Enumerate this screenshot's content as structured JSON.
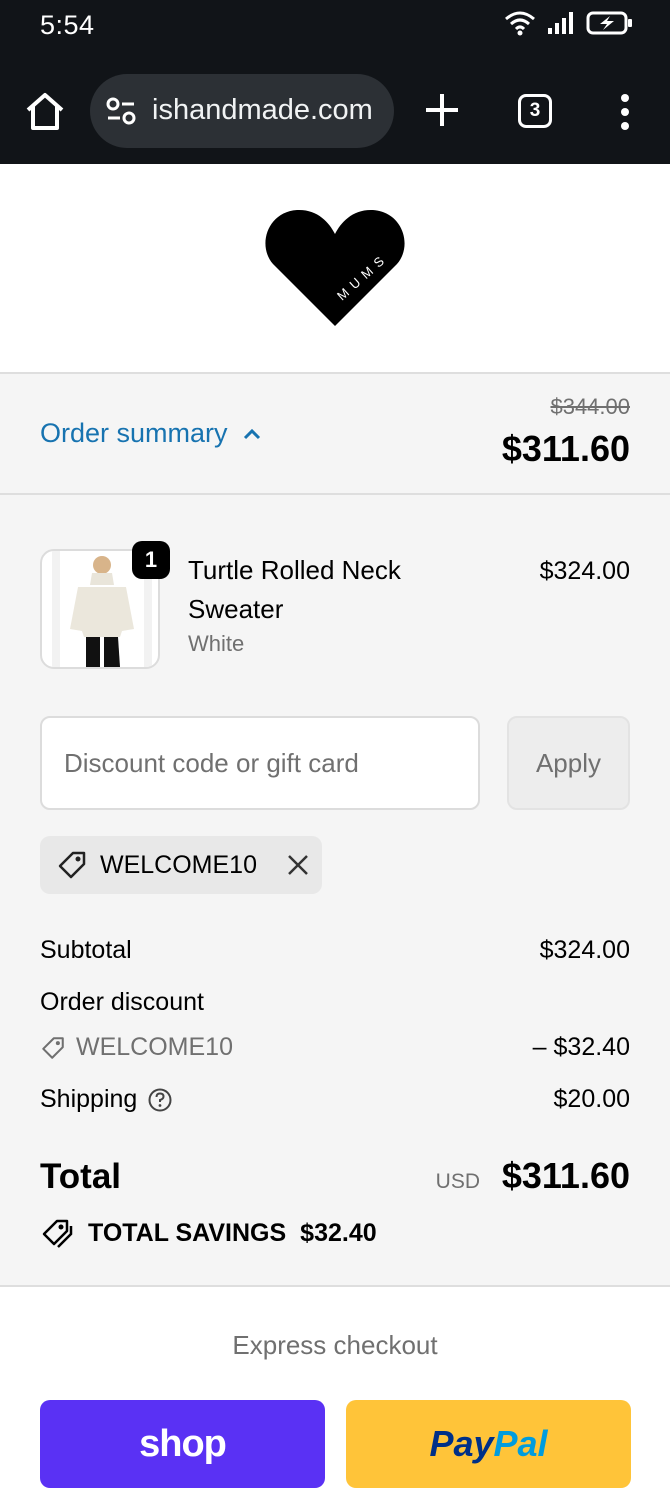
{
  "status_bar": {
    "time": "5:54"
  },
  "browser": {
    "url": "ishandmade.com",
    "tab_count": "3"
  },
  "brand": {
    "logo_text": "MUMS"
  },
  "order_summary": {
    "toggle_label": "Order summary",
    "original_price": "$344.00",
    "current_price": "$311.60"
  },
  "product": {
    "quantity": "1",
    "name": "Turtle Rolled Neck Sweater",
    "variant": "White",
    "price": "$324.00"
  },
  "discount": {
    "placeholder": "Discount code or gift card",
    "apply_label": "Apply",
    "applied_code": "WELCOME10"
  },
  "totals": {
    "subtotal_label": "Subtotal",
    "subtotal_value": "$324.00",
    "order_discount_label": "Order discount",
    "discount_code": "WELCOME10",
    "discount_value": "– $32.40",
    "shipping_label": "Shipping",
    "shipping_value": "$20.00",
    "total_label": "Total",
    "currency": "USD",
    "total_value": "$311.60",
    "savings_label": "TOTAL SAVINGS",
    "savings_value": "$32.40"
  },
  "express": {
    "label": "Express checkout",
    "shop_label": "shop",
    "paypal_part1": "Pay",
    "paypal_part2": "Pal"
  },
  "colors": {
    "link_blue": "#1773b0",
    "shop_purple": "#5a31f4",
    "paypal_yellow": "#ffc439"
  }
}
